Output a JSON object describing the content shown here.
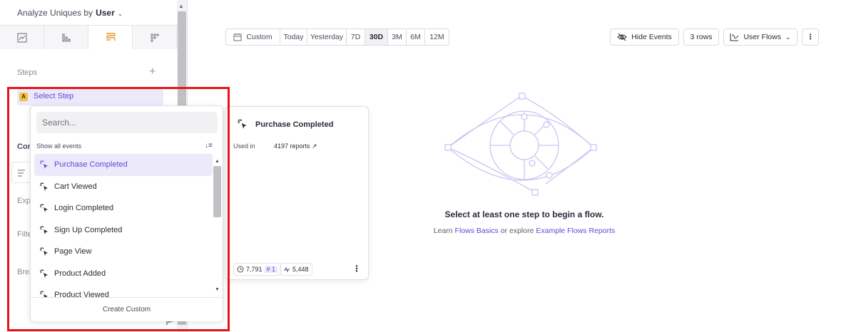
{
  "sidebar": {
    "analyze_label": "Analyze Uniques by",
    "analyze_value": "User",
    "view_tabs": [
      {
        "name": "line-chart"
      },
      {
        "name": "bar-chart"
      },
      {
        "name": "flows",
        "active": true
      },
      {
        "name": "grid"
      }
    ],
    "steps_label": "Steps",
    "step": {
      "badge": "A",
      "label": "Select Step"
    },
    "peek_labels": [
      "Con",
      "Expa",
      "Filte",
      "Brea"
    ]
  },
  "dropdown": {
    "search_placeholder": "Search...",
    "show_all_label": "Show all events",
    "items": [
      {
        "label": "Purchase Completed",
        "active": true
      },
      {
        "label": "Cart Viewed"
      },
      {
        "label": "Login Completed"
      },
      {
        "label": "Sign Up Completed"
      },
      {
        "label": "Page View"
      },
      {
        "label": "Product Added"
      },
      {
        "label": "Product Viewed"
      }
    ],
    "create_custom": "Create Custom"
  },
  "preview": {
    "title": "Purchase Completed",
    "used_label": "Used in",
    "used_value": "4197 reports ↗",
    "stat_users": "7,791",
    "stat_rank": "# 1",
    "stat_volume": "5,448"
  },
  "toolbar": {
    "date_ranges": [
      "Custom",
      "Today",
      "Yesterday",
      "7D",
      "30D",
      "3M",
      "6M",
      "12M"
    ],
    "active_range": "30D",
    "hide_events": "Hide Events",
    "rows": "3 rows",
    "chart_type": "User Flows"
  },
  "empty_state": {
    "title": "Select at least one step to begin a flow.",
    "learn": "Learn",
    "flows_basics": "Flows Basics",
    "or_explore": "or explore",
    "example_reports": "Example Flows Reports"
  },
  "colors": {
    "accent": "#5b4bd8",
    "highlight": "#e8141c",
    "badge": "#f6c244"
  }
}
